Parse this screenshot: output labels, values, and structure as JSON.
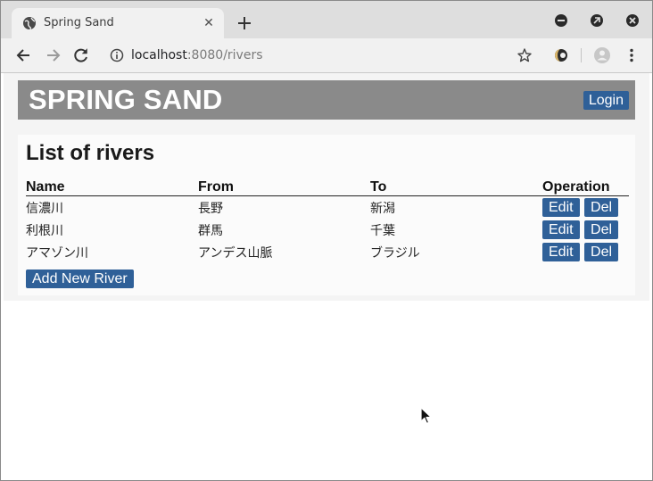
{
  "browser": {
    "tab_title": "Spring Sand",
    "tab_close": "✕",
    "url_host": "localhost",
    "url_rest": ":8080/rivers"
  },
  "page": {
    "brand": "SPRING SAND",
    "login_label": "Login",
    "title": "List of rivers",
    "columns": [
      "Name",
      "From",
      "To",
      "Operation"
    ],
    "rows": [
      {
        "name": "信濃川",
        "from": "長野",
        "to": "新潟"
      },
      {
        "name": "利根川",
        "from": "群馬",
        "to": "千葉"
      },
      {
        "name": "アマゾン川",
        "from": "アンデス山脈",
        "to": "ブラジル"
      }
    ],
    "edit_label": "Edit",
    "del_label": "Del",
    "add_label": "Add New River"
  },
  "colors": {
    "accent": "#2f6098",
    "header_bar": "#8a8a8a"
  },
  "icons": [
    "globe-icon",
    "close-icon",
    "plus-icon",
    "minimize-icon",
    "restore-icon",
    "window-close-icon",
    "back-icon",
    "forward-icon",
    "reload-icon",
    "info-icon",
    "star-icon",
    "extension-icon",
    "profile-icon",
    "menu-icon",
    "cursor-icon"
  ]
}
